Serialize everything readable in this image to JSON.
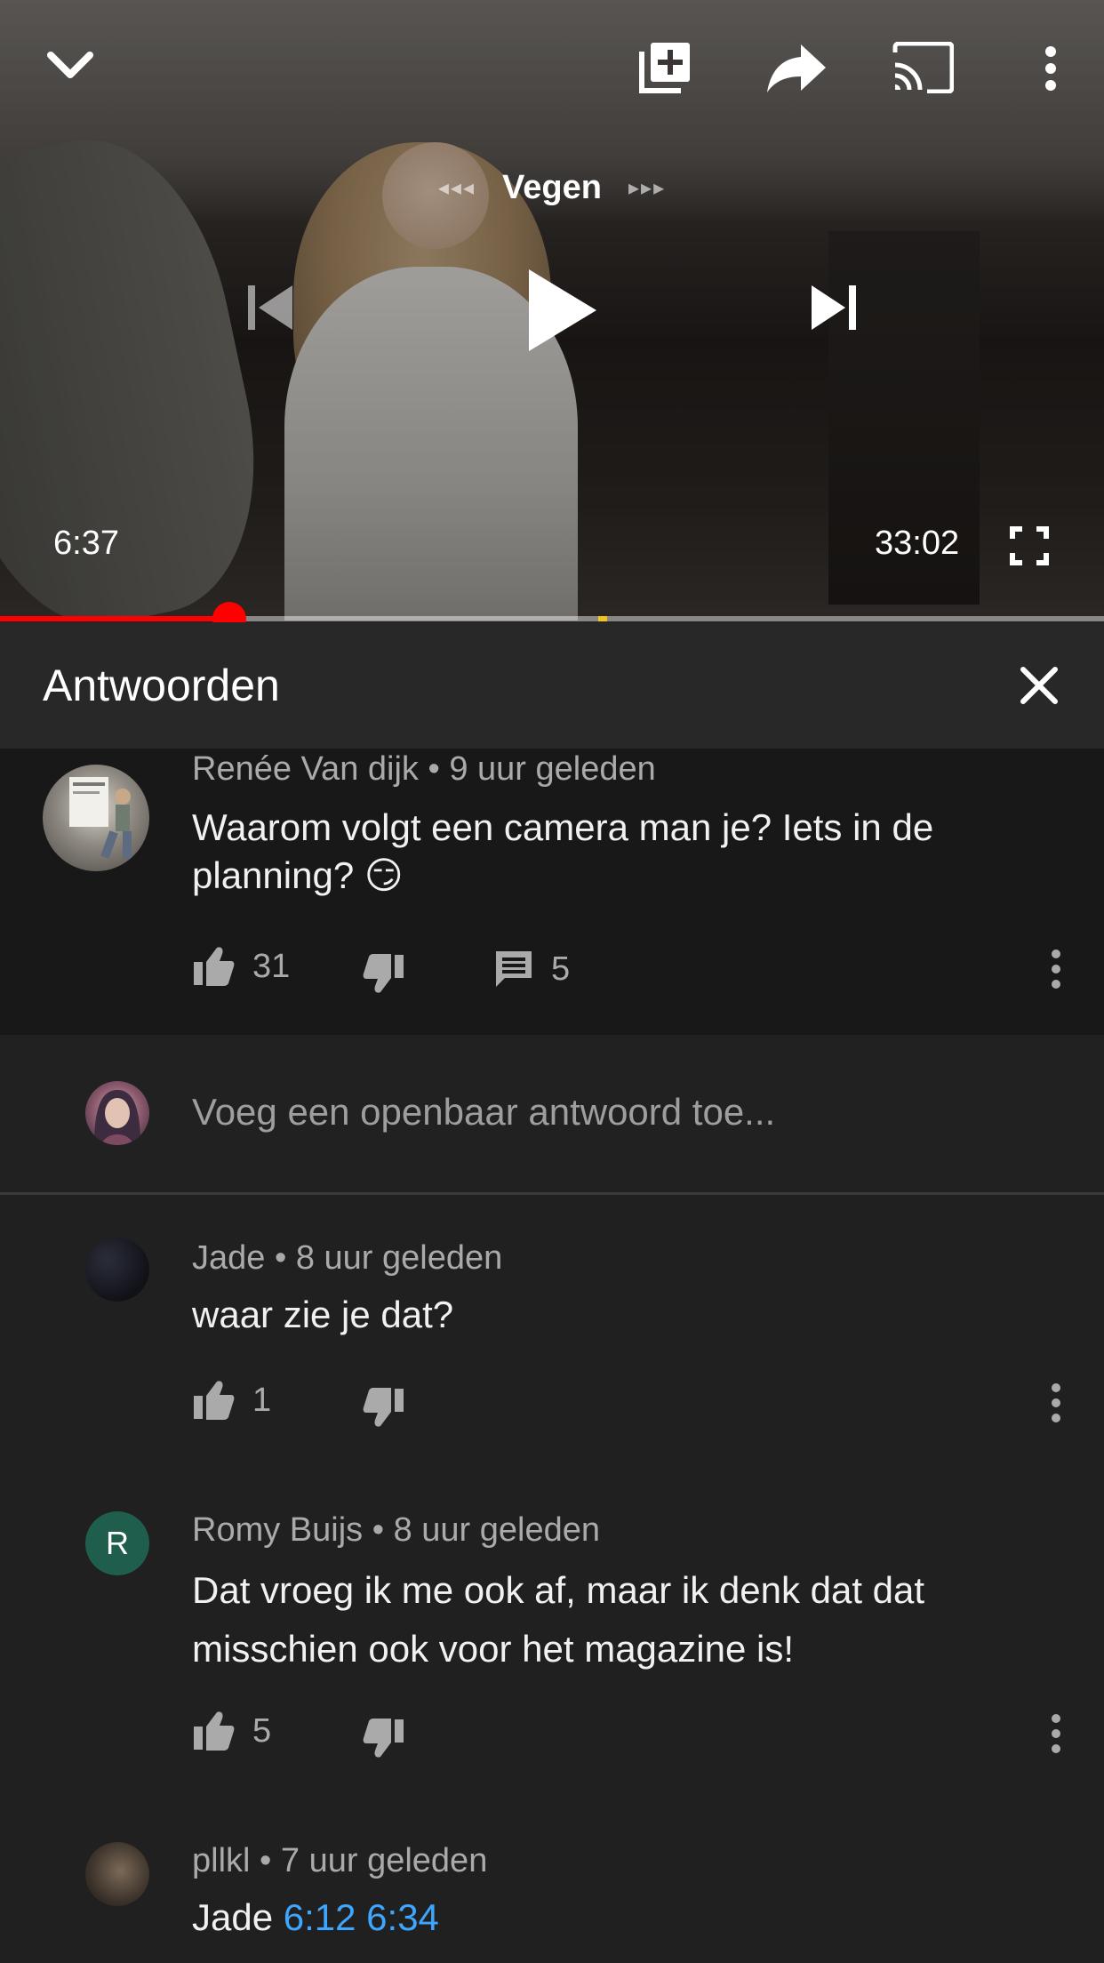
{
  "player": {
    "title": "Vegen",
    "prev_arrows": "◂◂◂",
    "next_arrows": "▸▸▸",
    "current_time": "6:37",
    "duration": "33:02",
    "progress_fraction": 0.208,
    "chapter_marker_fraction": 0.546
  },
  "replies": {
    "title": "Antwoorden"
  },
  "main_comment": {
    "author": "Renée Van dijk",
    "separator": "•",
    "time": "9 uur geleden",
    "text": "Waarom volgt een camera man je? Iets in de planning? 😏",
    "likes": "31",
    "replies_count": "5"
  },
  "reply_box": {
    "placeholder": "Voeg een openbaar antwoord toe..."
  },
  "comments": [
    {
      "author": "Jade",
      "separator": "•",
      "time": "8 uur geleden",
      "text": "waar zie je dat?",
      "likes": "1",
      "avatar_letter": ""
    },
    {
      "author": "Romy Buijs",
      "separator": "•",
      "time": "8 uur geleden",
      "text": "Dat vroeg ik me ook af, maar ik denk dat dat misschien ook voor het magazine is!",
      "likes": "5",
      "avatar_letter": "R"
    },
    {
      "author": "pllkl",
      "separator": "•",
      "time": "7 uur geleden",
      "text_prefix": "Jade ",
      "links": [
        "6:12",
        "6:34"
      ]
    }
  ],
  "colors": {
    "accent": "#ff0000",
    "link": "#3ea6ff",
    "marker": "#f2c21d",
    "avatar_r": "#1f5e4d"
  }
}
